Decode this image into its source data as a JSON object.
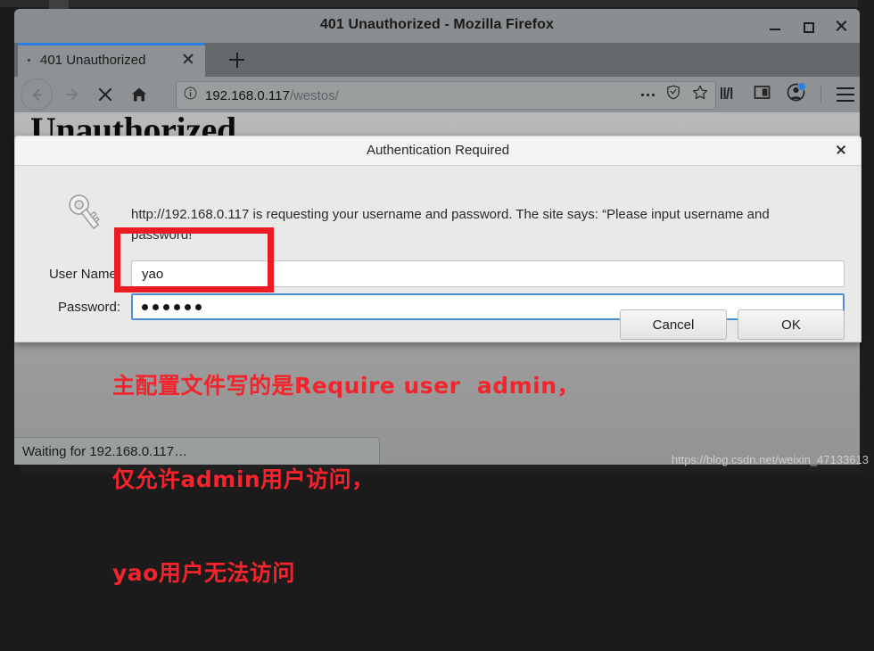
{
  "window": {
    "title": "401 Unauthorized - Mozilla Firefox",
    "minimize_label": "Minimize",
    "maximize_label": "Maximize",
    "close_label": "Close"
  },
  "tabs": {
    "active": {
      "title": "401 Unauthorized",
      "close_label": "Close tab"
    },
    "new_tab_label": "New tab"
  },
  "toolbar": {
    "back": "Back",
    "forward": "Forward",
    "stop": "Stop",
    "home": "Home",
    "library": "Library",
    "sidebar": "Sidebar",
    "account": "Account",
    "menu": "Open menu"
  },
  "urlbar": {
    "identity_icon": "info-icon",
    "host": "192.168.0.117",
    "path": "/westos/",
    "page_actions": "Page actions",
    "tracking_protection": "Tracking protection",
    "bookmark": "Bookmark this page"
  },
  "page": {
    "heading": "Unauthorized"
  },
  "status": {
    "text": "Waiting for 192.168.0.117…"
  },
  "dialog": {
    "title": "Authentication Required",
    "close_label": "Close dialog",
    "icon": "key-icon",
    "message": "http://192.168.0.117 is requesting your username and password. The site says: “Please input username and password!”",
    "username_label": "User Name:",
    "username_value": "yao",
    "password_label": "Password:",
    "password_value": "●●●●●●",
    "password_dot_count": 6,
    "cancel_label": "Cancel",
    "ok_label": "OK"
  },
  "annotation": {
    "highlight_color": "#ed1c24",
    "text_color": "#f4232c",
    "lines": [
      "主配置文件写的是Require user  admin，",
      "仅允许admin用户访问，",
      "yao用户无法访问"
    ]
  },
  "watermark": {
    "text": "https://blog.csdn.net/weixin_47133613"
  }
}
